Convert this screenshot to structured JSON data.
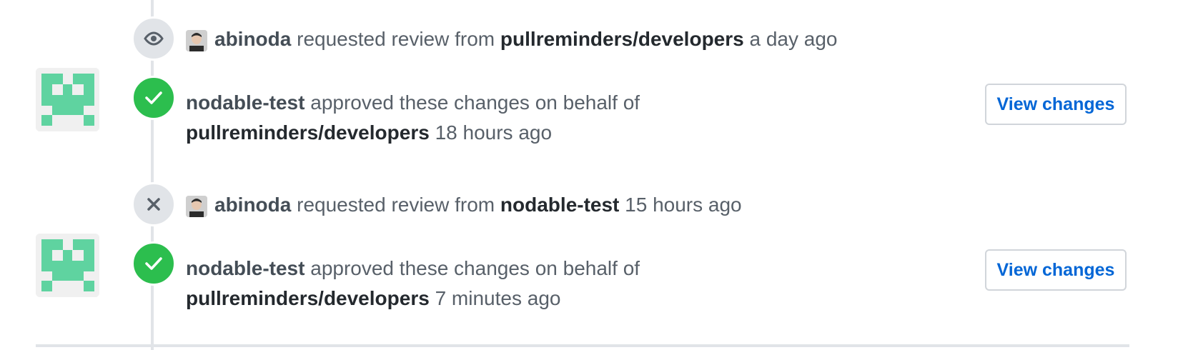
{
  "events": [
    {
      "type": "review_requested",
      "icon": "eye-icon",
      "actor": "abinoda",
      "text": " requested review from ",
      "target": "pullreminders/developers",
      "time": " a day ago"
    },
    {
      "type": "approved",
      "icon": "check-icon",
      "actor": "nodable-test",
      "text": " approved these changes on behalf of",
      "target": "pullreminders/developers",
      "time": " 18 hours ago",
      "button": "View changes"
    },
    {
      "type": "review_request_removed",
      "icon": "x-icon",
      "actor": "abinoda",
      "text": " requested review from ",
      "target": "nodable-test",
      "time": " 15 hours ago"
    },
    {
      "type": "approved",
      "icon": "check-icon",
      "actor": "nodable-test",
      "text": " approved these changes on behalf of",
      "target": "pullreminders/developers",
      "time": " 7 minutes ago",
      "button": "View changes"
    }
  ],
  "colors": {
    "approved": "#2cbe4e",
    "neutral_badge": "#e1e4e8",
    "link": "#0366d6",
    "identicon": "#5fd3a0"
  }
}
